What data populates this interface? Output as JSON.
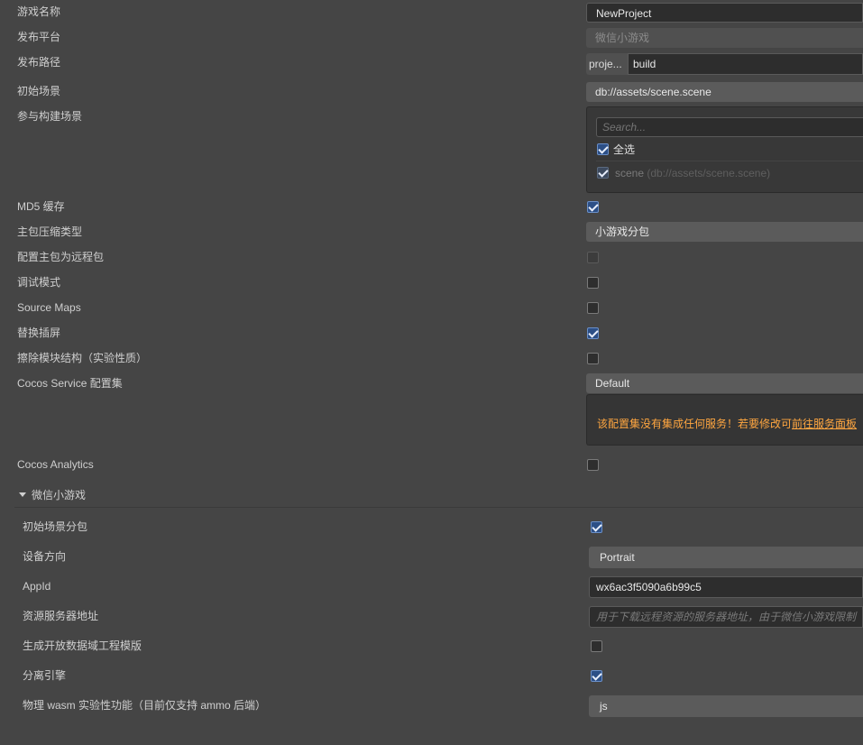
{
  "rows": {
    "game_name": {
      "label": "游戏名称",
      "value": "NewProject"
    },
    "platform": {
      "label": "发布平台",
      "value": "微信小游戏"
    },
    "build_path": {
      "label": "发布路径",
      "prefix": "proje...",
      "value": "build"
    },
    "start_scene": {
      "label": "初始场景",
      "value": "db://assets/scene.scene"
    },
    "scenes": {
      "label": "参与构建场景",
      "search_placeholder": "Search...",
      "select_all_label": "全选",
      "scene_name": "scene",
      "scene_path": "(db://assets/scene.scene)"
    },
    "md5": {
      "label": "MD5 缓存"
    },
    "compression": {
      "label": "主包压缩类型",
      "value": "小游戏分包"
    },
    "remote_main": {
      "label": "配置主包为远程包"
    },
    "debug": {
      "label": "调试模式"
    },
    "source_maps": {
      "label": "Source Maps"
    },
    "splash": {
      "label": "替换插屏"
    },
    "erase_modules": {
      "label": "擦除模块结构（实验性质）"
    },
    "cocos_service": {
      "label": "Cocos Service 配置集",
      "value": "Default",
      "notice": "该配置集没有集成任何服务！若要修改可",
      "link": "前往服务面板"
    },
    "analytics": {
      "label": "Cocos Analytics"
    }
  },
  "wechat": {
    "section_title": "微信小游戏",
    "start_scene_subpackage": {
      "label": "初始场景分包"
    },
    "orientation": {
      "label": "设备方向",
      "value": "Portrait"
    },
    "appid": {
      "label": "AppId",
      "value": "wx6ac3f5090a6b99c5"
    },
    "server": {
      "label": "资源服务器地址",
      "placeholder": "用于下载远程资源的服务器地址，由于微信小游戏限制"
    },
    "open_data": {
      "label": "生成开放数据域工程模版"
    },
    "separate_engine": {
      "label": "分离引擎"
    },
    "physics_wasm": {
      "label": "物理 wasm 实验性功能（目前仅支持 ammo 后端）",
      "value": "js"
    }
  },
  "colors": {
    "accent": "#2c4f86",
    "link": "#ffa640"
  }
}
